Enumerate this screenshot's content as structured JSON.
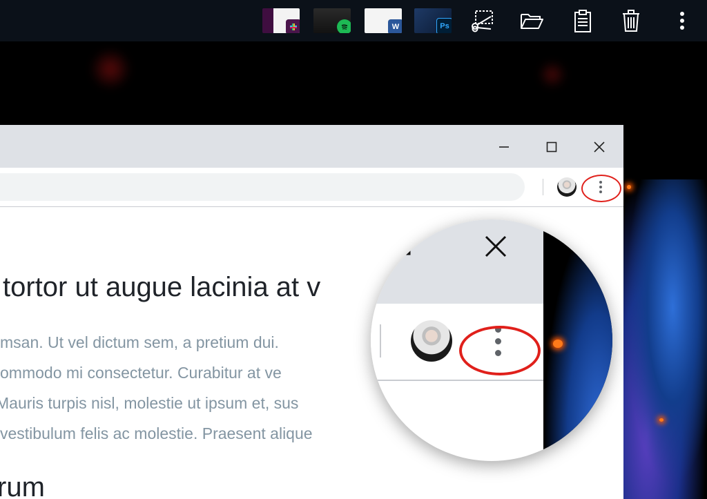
{
  "taskbar": {
    "thumbnails": [
      {
        "name": "slack-window-thumb",
        "badge_icon": "slack-icon",
        "badge_color": "#4a154b",
        "badge_text": ""
      },
      {
        "name": "spotify-window-thumb",
        "badge_icon": "spotify-icon",
        "badge_color": "#1db954",
        "badge_text": ""
      },
      {
        "name": "word-window-thumb",
        "badge_icon": "word-icon",
        "badge_color": "#2b579a",
        "badge_text": "W"
      },
      {
        "name": "photoshop-window-thumb",
        "badge_icon": "photoshop-icon",
        "badge_color": "#001e36",
        "badge_text": "Ps"
      }
    ],
    "tools": [
      "screenshot-scissors-icon",
      "folder-open-icon",
      "clipboard-icon",
      "trash-icon",
      "more-vertical-icon"
    ]
  },
  "window": {
    "controls": [
      "minimize-icon",
      "maximize-icon",
      "close-icon"
    ]
  },
  "content": {
    "heading": "tortor ut augue lacinia at v",
    "paragraph_lines": [
      "msan. Ut vel dictum sem, a pretium dui.",
      "ommodo mi consectetur. Curabitur at ve",
      "Mauris turpis nisl, molestie ut ipsum et, sus",
      "vestibulum felis ac molestie. Praesent alique"
    ],
    "subheading": "rum"
  },
  "colors": {
    "highlight": "#e0201b",
    "titlebar": "#dee1e6",
    "paragraph_text": "#8395a2"
  }
}
